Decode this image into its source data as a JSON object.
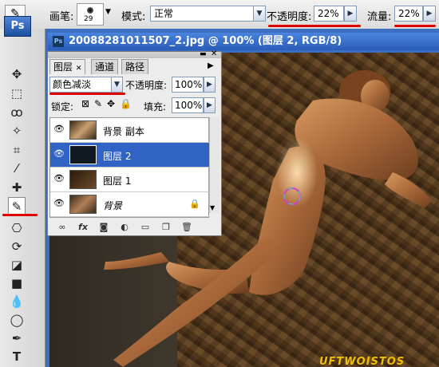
{
  "options_bar": {
    "brush_label": "画笔:",
    "brush_size": "29",
    "mode_label": "模式:",
    "mode_value": "正常",
    "opacity_label": "不透明度:",
    "opacity_value": "22%",
    "flow_label": "流量:",
    "flow_value": "22%"
  },
  "toolbox": {
    "logo": "Ps",
    "tools": [
      "move-tool",
      "marquee-tool",
      "lasso-tool",
      "magic-wand-tool",
      "crop-tool",
      "eyedropper-tool",
      "healing-brush-tool",
      "brush-tool",
      "clone-stamp-tool",
      "history-brush-tool",
      "eraser-tool",
      "gradient-tool",
      "blur-tool",
      "dodge-tool",
      "pen-tool",
      "type-tool"
    ]
  },
  "document": {
    "title": "20088281011507_2.jpg @ 100% (图层 2, RGB/8)",
    "watermark": "UFTWOISTOS"
  },
  "layers_panel": {
    "tabs": [
      "图层",
      "通道",
      "路径"
    ],
    "blend_mode": "颜色减淡",
    "opacity_label": "不透明度:",
    "opacity_value": "100%",
    "lock_label": "锁定:",
    "fill_label": "填充:",
    "fill_value": "100%",
    "layers": [
      {
        "name": "背景 副本",
        "selected": false,
        "locked": false
      },
      {
        "name": "图层 2",
        "selected": true,
        "locked": false
      },
      {
        "name": "图层 1",
        "selected": false,
        "locked": false
      },
      {
        "name": "背景",
        "selected": false,
        "locked": true
      }
    ]
  },
  "colors": {
    "highlight_underline": "#e00000",
    "selection": "#3163c5",
    "title_bar": "#2a5cb8"
  }
}
